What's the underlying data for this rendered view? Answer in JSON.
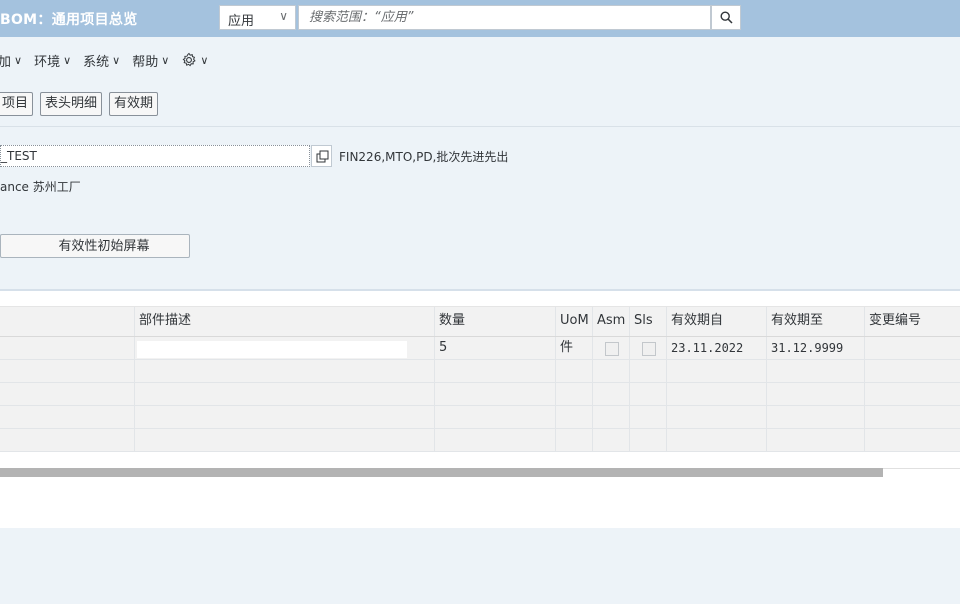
{
  "titlebar": {
    "title": "BOM：通用项目总览",
    "scope_label": "应用",
    "search_placeholder": "搜索范围：“应用”"
  },
  "menu": {
    "items": [
      "加",
      "环境",
      "系统",
      "帮助"
    ]
  },
  "toolbar": {
    "buttons": [
      "项目",
      "表头明细",
      "有效期"
    ]
  },
  "header": {
    "material_value": "_TEST",
    "material_description": "FIN226,MTO,PD,批次先进先出",
    "plant_text": "ance 苏州工厂",
    "validity_button": "有效性初始屏幕"
  },
  "table": {
    "columns": [
      "",
      "部件描述",
      "数量",
      "UoM",
      "Asm",
      "Sls",
      "有效期自",
      "有效期至",
      "变更编号"
    ],
    "rows": [
      {
        "description": "",
        "quantity": "5",
        "uom": "件",
        "valid_from": "23.11.2022",
        "valid_to": "31.12.9999",
        "change_no": ""
      },
      {
        "description": "",
        "quantity": "",
        "uom": "",
        "valid_from": "",
        "valid_to": "",
        "change_no": ""
      },
      {
        "description": "",
        "quantity": "",
        "uom": "",
        "valid_from": "",
        "valid_to": "",
        "change_no": ""
      },
      {
        "description": "",
        "quantity": "",
        "uom": "",
        "valid_from": "",
        "valid_to": "",
        "change_no": ""
      },
      {
        "description": "",
        "quantity": "",
        "uom": "",
        "valid_from": "",
        "valid_to": "",
        "change_no": ""
      }
    ]
  },
  "icons": {
    "search": "search-icon",
    "value_help": "value-help-icon",
    "settings": "gear-icon",
    "dropdown": "chevron-down-icon"
  },
  "colors": {
    "titlebar": "#a4c2de",
    "background": "#edf3f8",
    "scroll_thumb": "#b3b3b3"
  }
}
